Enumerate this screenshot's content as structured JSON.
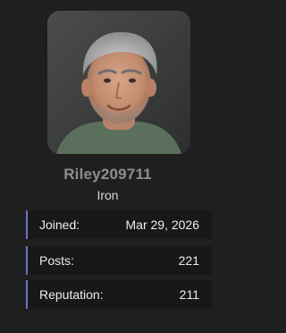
{
  "profile": {
    "avatar_alt": "User avatar photo",
    "username": "Riley209711",
    "rank": "Iron"
  },
  "stats": [
    {
      "label": "Joined:",
      "value": "Mar 29, 2026"
    },
    {
      "label": "Posts:",
      "value": "221"
    },
    {
      "label": "Reputation:",
      "value": "211"
    }
  ],
  "colors": {
    "background": "#1f1f1f",
    "row_background": "#181818",
    "accent": "#6a73c9",
    "username": "#8e8e8e"
  }
}
